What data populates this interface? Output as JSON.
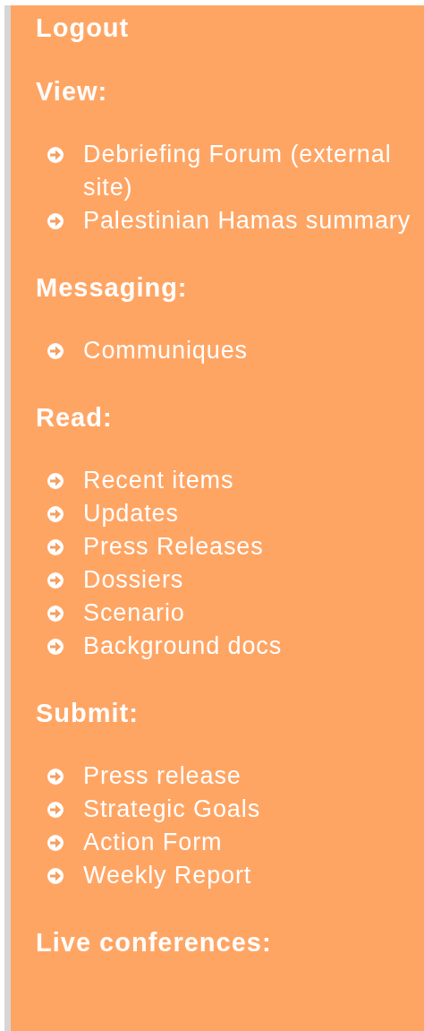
{
  "logout": "Logout",
  "sections": [
    {
      "heading": "View:",
      "items": [
        "Debriefing Forum (external site)",
        "Palestinian Hamas summary"
      ]
    },
    {
      "heading": "Messaging:",
      "items": [
        "Communiques"
      ]
    },
    {
      "heading": "Read:",
      "items": [
        "Recent items",
        "Updates",
        "Press Releases",
        "Dossiers",
        "Scenario",
        "Background docs"
      ]
    },
    {
      "heading": "Submit:",
      "items": [
        "Press release",
        "Strategic Goals",
        "Action Form",
        "Weekly Report"
      ]
    },
    {
      "heading": "Live conferences:"
    }
  ]
}
